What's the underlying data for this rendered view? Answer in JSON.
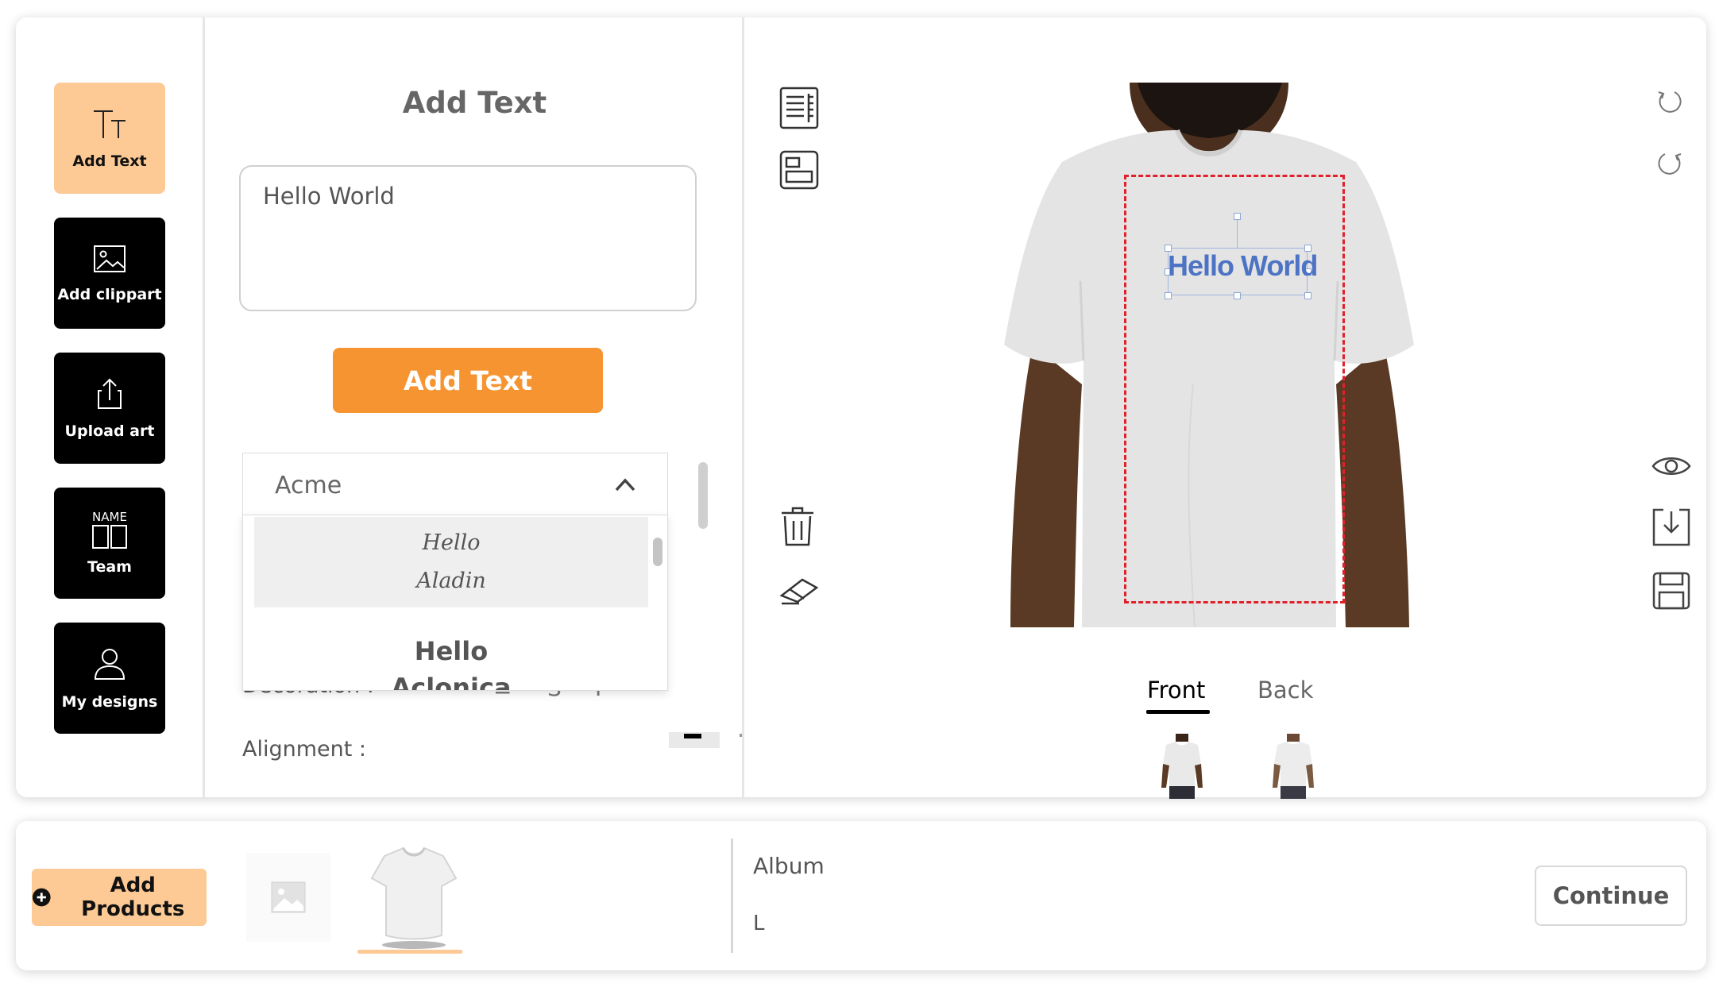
{
  "tools": [
    {
      "label": "Add Text",
      "icon": "text-size-icon",
      "active": true
    },
    {
      "label": "Add clippart",
      "icon": "image-icon",
      "active": false
    },
    {
      "label": "Upload art",
      "icon": "upload-icon",
      "active": false
    },
    {
      "label": "Team",
      "icon": "team-name-icon",
      "icon_text": "NAME",
      "active": false
    },
    {
      "label": "My designs",
      "icon": "user-icon",
      "active": false
    }
  ],
  "text_panel": {
    "title": "Add Text",
    "input_value": "Hello World",
    "add_button": "Add Text",
    "font_selected": "Acme",
    "font_options": [
      {
        "line1": "Hello",
        "line2": "Aladin"
      },
      {
        "line1": "Hello",
        "line2": "Aclonica"
      }
    ],
    "decoration_label": "Decoration :",
    "alignment_label": "Alignment :"
  },
  "canvas": {
    "design_text": "Hello World",
    "design_color": "#4d73c4",
    "print_area_color": "#e2202a",
    "views": [
      {
        "label": "Front",
        "active": true
      },
      {
        "label": "Back",
        "active": false
      }
    ]
  },
  "bottom": {
    "add_products": "Add Products",
    "album": "Album",
    "size": "L",
    "continue": "Continue"
  },
  "colors": {
    "accent_orange": "#f79432",
    "accent_light": "#fdc995",
    "tool_dark": "#000000"
  }
}
